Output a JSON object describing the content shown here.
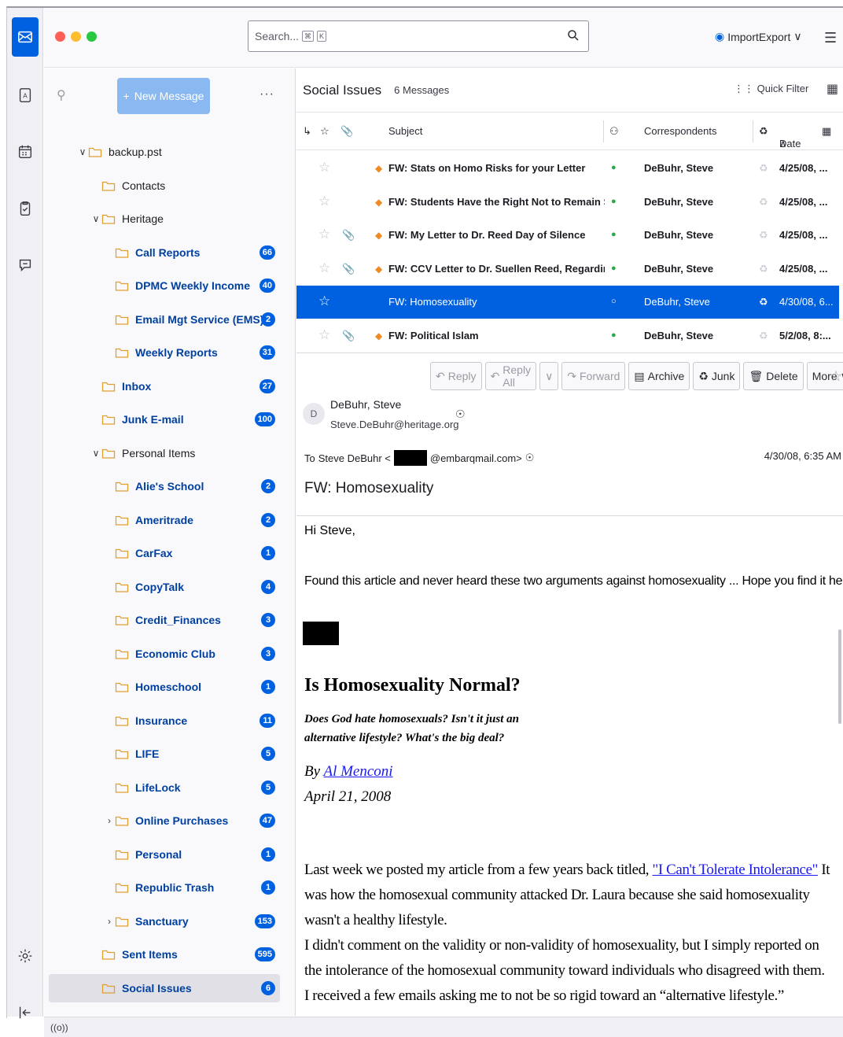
{
  "titlebar": {
    "search_placeholder": "Search...",
    "search_kbd_1": "⌘",
    "search_kbd_2": "K",
    "account": "ImportExport"
  },
  "folder_pane": {
    "new_message": "New Message",
    "folders": [
      {
        "name": "backup.pst",
        "badge": "",
        "unread": false,
        "level": 0,
        "twisty": "∨"
      },
      {
        "name": "Contacts",
        "badge": "",
        "unread": false,
        "level": 1,
        "twisty": ""
      },
      {
        "name": "Heritage",
        "badge": "",
        "unread": false,
        "level": 1,
        "twisty": "∨"
      },
      {
        "name": "Call Reports",
        "badge": "66",
        "unread": true,
        "level": 2,
        "twisty": ""
      },
      {
        "name": "DPMC Weekly Income",
        "badge": "40",
        "unread": true,
        "level": 2,
        "twisty": ""
      },
      {
        "name": "Email Mgt Service (EMS)",
        "badge": "2",
        "unread": true,
        "level": 2,
        "twisty": ""
      },
      {
        "name": "Weekly Reports",
        "badge": "31",
        "unread": true,
        "level": 2,
        "twisty": ""
      },
      {
        "name": "Inbox",
        "badge": "27",
        "unread": true,
        "level": 1,
        "twisty": ""
      },
      {
        "name": "Junk E-mail",
        "badge": "100",
        "unread": true,
        "level": 1,
        "twisty": ""
      },
      {
        "name": "Personal Items",
        "badge": "",
        "unread": false,
        "level": 1,
        "twisty": "∨"
      },
      {
        "name": "Alie's School",
        "badge": "2",
        "unread": true,
        "level": 2,
        "twisty": ""
      },
      {
        "name": "Ameritrade",
        "badge": "2",
        "unread": true,
        "level": 2,
        "twisty": ""
      },
      {
        "name": "CarFax",
        "badge": "1",
        "unread": true,
        "level": 2,
        "twisty": ""
      },
      {
        "name": "CopyTalk",
        "badge": "4",
        "unread": true,
        "level": 2,
        "twisty": ""
      },
      {
        "name": "Credit_Finances",
        "badge": "3",
        "unread": true,
        "level": 2,
        "twisty": ""
      },
      {
        "name": "Economic Club",
        "badge": "3",
        "unread": true,
        "level": 2,
        "twisty": ""
      },
      {
        "name": "Homeschool",
        "badge": "1",
        "unread": true,
        "level": 2,
        "twisty": ""
      },
      {
        "name": "Insurance",
        "badge": "11",
        "unread": true,
        "level": 2,
        "twisty": ""
      },
      {
        "name": "LIFE",
        "badge": "5",
        "unread": true,
        "level": 2,
        "twisty": ""
      },
      {
        "name": "LifeLock",
        "badge": "5",
        "unread": true,
        "level": 2,
        "twisty": ""
      },
      {
        "name": "Online Purchases",
        "badge": "47",
        "unread": true,
        "level": 2,
        "twisty": "›"
      },
      {
        "name": "Personal",
        "badge": "1",
        "unread": true,
        "level": 2,
        "twisty": ""
      },
      {
        "name": "Republic Trash",
        "badge": "1",
        "unread": true,
        "level": 2,
        "twisty": ""
      },
      {
        "name": "Sanctuary",
        "badge": "153",
        "unread": true,
        "level": 2,
        "twisty": "›"
      },
      {
        "name": "Sent Items",
        "badge": "595",
        "unread": true,
        "level": 1,
        "twisty": ""
      },
      {
        "name": "Social Issues",
        "badge": "6",
        "unread": true,
        "level": 1,
        "twisty": "",
        "selected": true
      }
    ]
  },
  "thread_pane": {
    "folder_title": "Social Issues",
    "message_count": "6 Messages",
    "quick_filter": "Quick Filter",
    "columns": {
      "subject": "Subject",
      "correspondents": "Correspondents",
      "date": "Date"
    },
    "rows": [
      {
        "subject": "FW: Stats on Homo Risks for your Letter",
        "correspondent": "DeBuhr, Steve",
        "date": "4/25/08, ...",
        "attachment": false,
        "selected": false
      },
      {
        "subject": "FW: Students Have the Right Not to Remain Si...",
        "correspondent": "DeBuhr, Steve",
        "date": "4/25/08, ...",
        "attachment": false,
        "selected": false
      },
      {
        "subject": "FW: My Letter to Dr. Reed Day of Silence",
        "correspondent": "DeBuhr, Steve",
        "date": "4/25/08, ...",
        "attachment": true,
        "selected": false
      },
      {
        "subject": "FW: CCV Letter to Dr. Suellen Reed, Regardin...",
        "correspondent": "DeBuhr, Steve",
        "date": "4/25/08, ...",
        "attachment": true,
        "selected": false
      },
      {
        "subject": "FW: Homosexuality",
        "correspondent": "DeBuhr, Steve",
        "date": "4/30/08, 6...",
        "attachment": false,
        "selected": true
      },
      {
        "subject": "FW: Political Islam",
        "correspondent": "DeBuhr, Steve",
        "date": "5/2/08, 8:...",
        "attachment": true,
        "selected": false
      }
    ]
  },
  "message": {
    "toolbar": {
      "reply": "Reply",
      "reply_all": "Reply All",
      "forward": "Forward",
      "archive": "Archive",
      "junk": "Junk",
      "delete": "Delete",
      "more": "More"
    },
    "avatar_letter": "D",
    "from_name": "DeBuhr, Steve",
    "from_addr": "Steve.DeBuhr@heritage.org",
    "to_label": "To",
    "to_name": "Steve DeBuhr <",
    "to_domain": "@embarqmail.com>",
    "date": "4/30/08, 6:35 AM",
    "subject": "FW: Homosexuality",
    "body": {
      "greeting": "Hi Steve,",
      "intro": "Found this article and never heard these two arguments against homosexuality ... Hope you find it helpful.",
      "article_title": "Is Homosexuality Normal?",
      "article_subtitle": "Does God hate homosexuals? Isn't it just an alternative lifestyle? What's the big deal?",
      "by": "By",
      "author": "Al Menconi",
      "article_date": "April 21, 2008",
      "p1_a": "Last week we posted my article from a few years back titled, ",
      "p1_link": "\"I Can't Tolerate Intolerance\"",
      "p1_b": " It was how the homosexual community attacked Dr. Laura because she said homosexuality wasn't a healthy lifestyle.",
      "p2": "I didn't comment on the validity or non-validity of homosexuality, but I simply reported on the intolerance of the homosexual community toward individuals who disagreed with them. I received a few emails asking me to not be so rigid toward an “alternative lifestyle.”"
    }
  },
  "status": {
    "icon": "((o))"
  },
  "colors": {
    "accent": "#0061e0",
    "unread_folder": "#0040a0",
    "new_message_btn": "#8ab8f0"
  }
}
